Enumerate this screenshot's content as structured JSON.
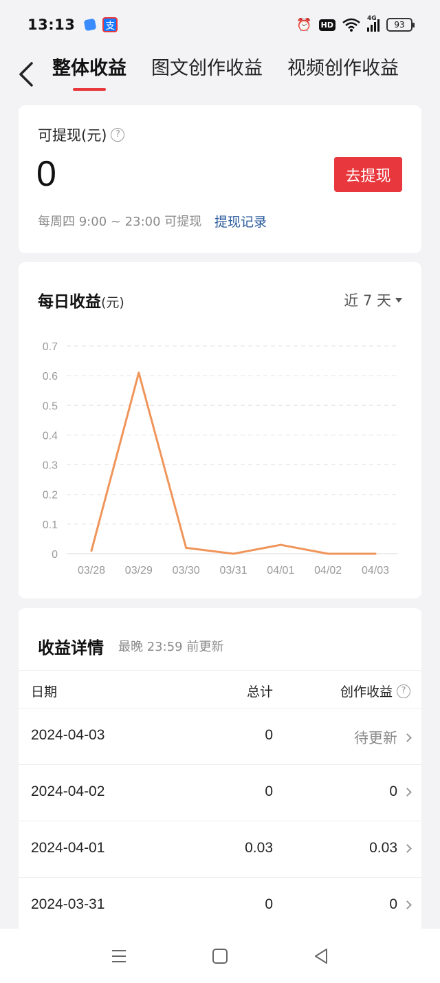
{
  "status_bar": {
    "time": "13:13",
    "hd": "HD",
    "network": "4G",
    "battery": "93"
  },
  "nav": {
    "tabs": [
      {
        "label": "整体收益",
        "active": true
      },
      {
        "label": "图文创作收益",
        "active": false
      },
      {
        "label": "视频创作收益",
        "active": false
      }
    ]
  },
  "withdraw": {
    "label": "可提现(元)",
    "amount": "0",
    "button_label": "去提现",
    "note": "每周四 9:00 ~ 23:00 可提现",
    "record_link": "提现记录"
  },
  "daily": {
    "title": "每日收益",
    "unit": "(元)",
    "range": "近 7 天"
  },
  "chart_data": {
    "type": "line",
    "categories": [
      "03/28",
      "03/29",
      "03/30",
      "03/31",
      "04/01",
      "04/02",
      "04/03"
    ],
    "values": [
      0.01,
      0.61,
      0.02,
      0.0,
      0.03,
      0.0,
      0.0
    ],
    "yticks": [
      "0",
      "0.1",
      "0.2",
      "0.3",
      "0.4",
      "0.5",
      "0.6",
      "0.7"
    ],
    "ylim": [
      0,
      0.7
    ],
    "grid": true,
    "color": "#f0955a"
  },
  "detail": {
    "title": "收益详情",
    "subtitle": "最晚 23:59 前更新",
    "headers": {
      "date": "日期",
      "total": "总计",
      "creation": "创作收益"
    },
    "rows": [
      {
        "date": "2024-04-03",
        "total": "0",
        "creation": "待更新"
      },
      {
        "date": "2024-04-02",
        "total": "0",
        "creation": "0"
      },
      {
        "date": "2024-04-01",
        "total": "0.03",
        "creation": "0.03"
      },
      {
        "date": "2024-03-31",
        "total": "0",
        "creation": "0"
      }
    ]
  },
  "colors": {
    "accent": "#e8383d",
    "link": "#2a5a9c",
    "line": "#f0955a"
  }
}
